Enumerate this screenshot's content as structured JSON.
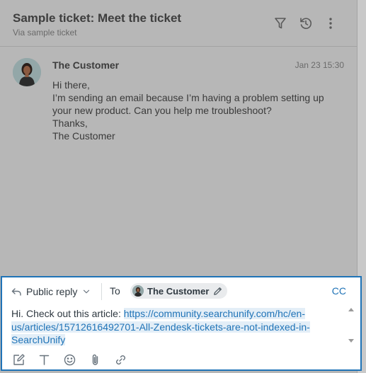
{
  "header": {
    "title": "Sample ticket: Meet the ticket",
    "subtitle": "Via sample ticket",
    "icons": [
      "filter-icon",
      "history-icon",
      "more-vertical-icon"
    ]
  },
  "message": {
    "author": "The Customer",
    "time": "Jan 23 15:30",
    "lines": [
      "Hi there,",
      "I’m sending an email because I’m having a problem setting up",
      "your new product. Can you help me troubleshoot?",
      "Thanks,",
      "The Customer"
    ]
  },
  "composer": {
    "reply_type": "Public reply",
    "to_label": "To",
    "recipient": "The Customer",
    "cc_label": "CC",
    "body_prefix": "Hi. Check out this article: ",
    "link_text": "https://community.searchunify.com/hc/en-us/articles/15712616492701-All-Zendesk-tickets-are-not-indexed-in-SearchUnify",
    "toolbar_icons": [
      "compose-icon",
      "text-format-icon",
      "emoji-icon",
      "attachment-icon",
      "link-icon"
    ]
  },
  "colors": {
    "accent": "#1f73b7",
    "overlay": "#b7b7b7",
    "chip": "#e9ebed"
  }
}
